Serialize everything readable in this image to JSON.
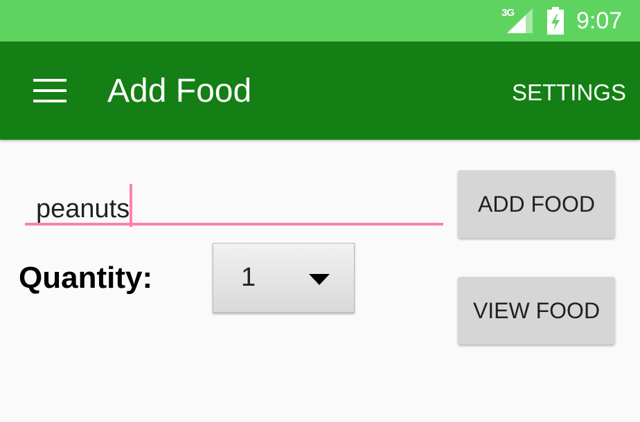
{
  "status_bar": {
    "network": "3G",
    "time": "9:07",
    "signal_icon": "signal-icon",
    "battery_icon": "battery-charging-icon"
  },
  "app_bar": {
    "menu_icon": "menu-icon",
    "title": "Add Food",
    "settings_label": "SETTINGS"
  },
  "form": {
    "food_input_value": "peanuts",
    "add_food_label": "ADD FOOD",
    "quantity_label": "Quantity:",
    "quantity_selected": "1",
    "dropdown_icon": "dropdown-arrow-icon",
    "view_food_label": "VIEW FOOD"
  },
  "colors": {
    "status_bar": "#5fd35f",
    "app_bar": "#147f14",
    "accent": "#ff80ab",
    "button": "#d6d6d6",
    "background": "#fafafa"
  }
}
